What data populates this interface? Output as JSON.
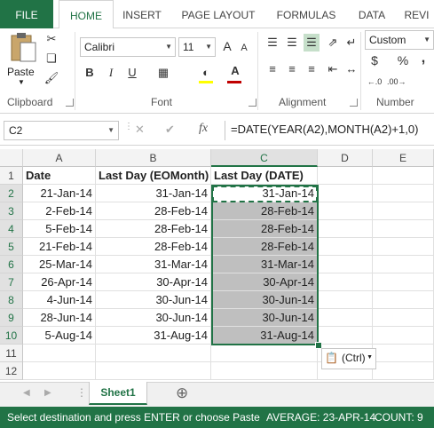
{
  "tabs": [
    "FILE",
    "HOME",
    "INSERT",
    "PAGE LAYOUT",
    "FORMULAS",
    "DATA",
    "REVI"
  ],
  "clipboard": {
    "paste": "Paste",
    "label": "Clipboard"
  },
  "font": {
    "name": "Calibri",
    "size": "11",
    "label": "Font",
    "bold": "B",
    "italic": "I",
    "underline": "U",
    "grow": "A",
    "shrink": "A",
    "color": "A"
  },
  "alignment": {
    "label": "Alignment"
  },
  "number": {
    "format": "Custom",
    "label": "Number",
    "currency": "$",
    "percent": "%",
    "comma": ","
  },
  "formula_bar": {
    "name_box": "C2",
    "cancel": "✕",
    "enter": "✔",
    "fx": "fx",
    "formula": "=DATE(YEAR(A2),MONTH(A2)+1,0)"
  },
  "columns": [
    "A",
    "B",
    "C",
    "D",
    "E"
  ],
  "rows": [
    "1",
    "2",
    "3",
    "4",
    "5",
    "6",
    "7",
    "8",
    "9",
    "10",
    "11",
    "12"
  ],
  "headers": {
    "a": "Date",
    "b": "Last Day (EOMonth)",
    "c": "Last Day (DATE)"
  },
  "data": [
    [
      "21-Jan-14",
      "31-Jan-14",
      "31-Jan-14"
    ],
    [
      "2-Feb-14",
      "28-Feb-14",
      "28-Feb-14"
    ],
    [
      "5-Feb-14",
      "28-Feb-14",
      "28-Feb-14"
    ],
    [
      "21-Feb-14",
      "28-Feb-14",
      "28-Feb-14"
    ],
    [
      "25-Mar-14",
      "31-Mar-14",
      "31-Mar-14"
    ],
    [
      "26-Apr-14",
      "30-Apr-14",
      "30-Apr-14"
    ],
    [
      "4-Jun-14",
      "30-Jun-14",
      "30-Jun-14"
    ],
    [
      "28-Jun-14",
      "30-Jun-14",
      "30-Jun-14"
    ],
    [
      "5-Aug-14",
      "31-Aug-14",
      "31-Aug-14"
    ]
  ],
  "paste_options": "(Ctrl)",
  "sheet_tab": "Sheet1",
  "add_sheet": "⊕",
  "status": {
    "message": "Select destination and press ENTER or choose Paste",
    "average": "AVERAGE: 23-APR-14",
    "count": "COUNT: 9"
  },
  "colors": {
    "accent": "#217346",
    "selection_fill": "#bfbfbf"
  }
}
